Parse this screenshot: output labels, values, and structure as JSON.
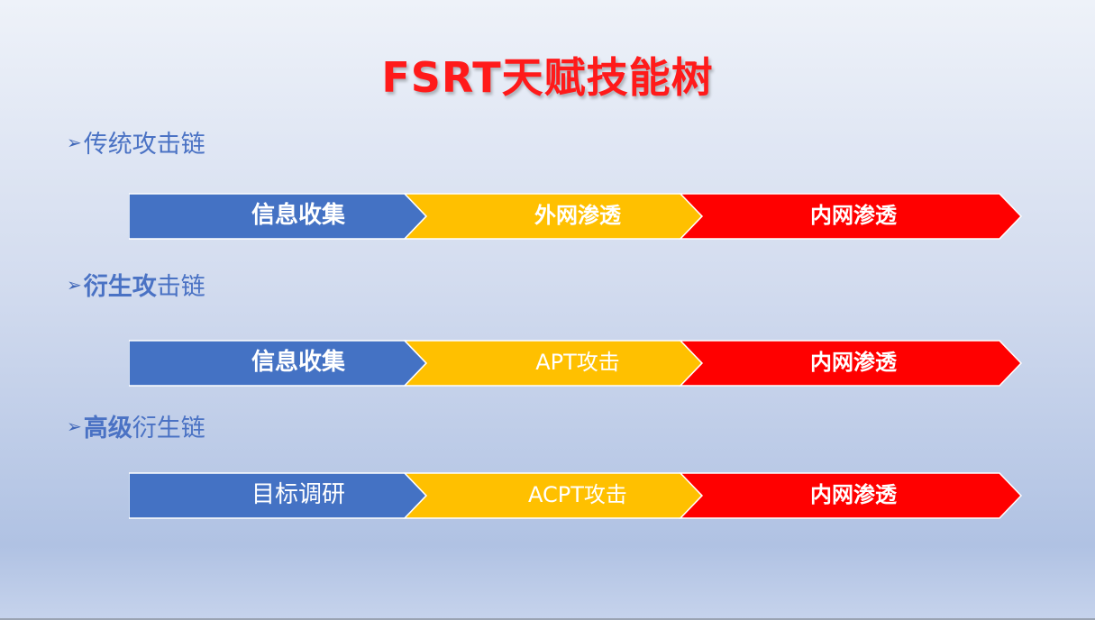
{
  "title": "FSRT天赋技能树",
  "colors": {
    "blue": "#4472c4",
    "yellow": "#ffc000",
    "red": "#ff0000",
    "heading": "#4a72c4",
    "title": "#ff1a1a"
  },
  "chains": [
    {
      "heading_bold": "",
      "heading_rest": "传统攻击链",
      "segments": [
        "信息收集",
        "外网渗透",
        "内网渗透"
      ]
    },
    {
      "heading_bold": "衍生攻",
      "heading_rest": "击链",
      "segments": [
        "信息收集",
        "APT攻击",
        "内网渗透"
      ]
    },
    {
      "heading_bold": "高级",
      "heading_rest": "衍生链",
      "segments": [
        "目标调研",
        "ACPT攻击",
        "内网渗透"
      ]
    }
  ]
}
